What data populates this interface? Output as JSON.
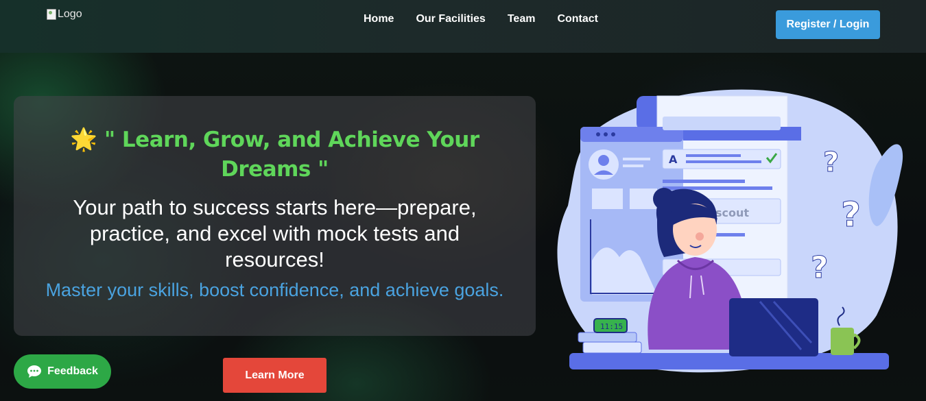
{
  "nav": {
    "logo_alt": "Logo",
    "links": [
      "Home",
      "Our Facilities",
      "Team",
      "Contact"
    ],
    "register_label": "Register / Login"
  },
  "hero": {
    "star_icon": "🌟",
    "heading": "\" Learn, Grow, and Achieve Your Dreams \"",
    "subtitle": "Your path to success starts here—prepare, practice, and excel with mock tests and resources!",
    "tagline": "Master your skills, boost confidence, and achieve goals.",
    "learn_more_label": "Learn More"
  },
  "feedback": {
    "label": "Feedback",
    "icon": "chat-bubble-icon"
  },
  "illustration": {
    "clock_text": "11:15",
    "doc_letter": "A",
    "watermark": "scout"
  },
  "colors": {
    "heading": "#5fd65a",
    "tagline": "#4aa3e0",
    "register_button": "#3a9bdc",
    "learn_more_button": "#e4473a",
    "feedback_button": "#2da846"
  }
}
